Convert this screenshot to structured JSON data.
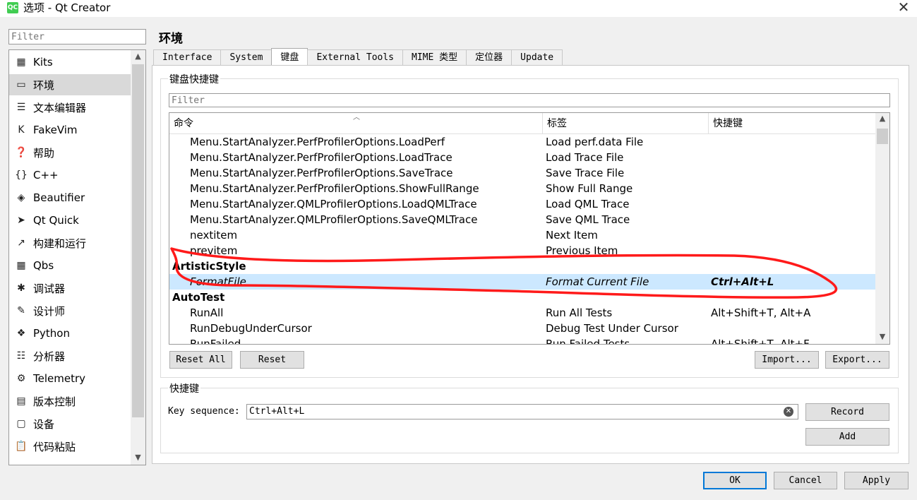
{
  "window": {
    "title": "选项 - Qt Creator",
    "app_icon_text": "QC"
  },
  "sidebar": {
    "filter_placeholder": "Filter",
    "items": [
      {
        "label": "Kits",
        "icon": "kits-icon",
        "glyph": "▦"
      },
      {
        "label": "环境",
        "icon": "monitor-icon",
        "glyph": "▭"
      },
      {
        "label": "文本编辑器",
        "icon": "text-editor-icon",
        "glyph": "☰"
      },
      {
        "label": "FakeVim",
        "icon": "fakevim-icon",
        "glyph": "K"
      },
      {
        "label": "帮助",
        "icon": "help-icon",
        "glyph": "❓"
      },
      {
        "label": "C++",
        "icon": "cpp-icon",
        "glyph": "{}"
      },
      {
        "label": "Beautifier",
        "icon": "beautifier-icon",
        "glyph": "◈"
      },
      {
        "label": "Qt Quick",
        "icon": "qt-quick-icon",
        "glyph": "➤"
      },
      {
        "label": "构建和运行",
        "icon": "build-run-icon",
        "glyph": "↗"
      },
      {
        "label": "Qbs",
        "icon": "qbs-icon",
        "glyph": "▦"
      },
      {
        "label": "调试器",
        "icon": "debugger-icon",
        "glyph": "✱"
      },
      {
        "label": "设计师",
        "icon": "designer-icon",
        "glyph": "✎"
      },
      {
        "label": "Python",
        "icon": "python-icon",
        "glyph": "❖"
      },
      {
        "label": "分析器",
        "icon": "analyzer-icon",
        "glyph": "☷"
      },
      {
        "label": "Telemetry",
        "icon": "telemetry-icon",
        "glyph": "⚙"
      },
      {
        "label": "版本控制",
        "icon": "version-control-icon",
        "glyph": "▤"
      },
      {
        "label": "设备",
        "icon": "device-icon",
        "glyph": "▢"
      },
      {
        "label": "代码粘贴",
        "icon": "code-paste-icon",
        "glyph": "📋"
      }
    ]
  },
  "page": {
    "title": "环境"
  },
  "tabs": [
    "Interface",
    "System",
    "键盘",
    "External Tools",
    "MIME 类型",
    "定位器",
    "Update"
  ],
  "shortcuts": {
    "group_title": "键盘快捷键",
    "filter_placeholder": "Filter",
    "columns": [
      "命令",
      "标签",
      "快捷键"
    ],
    "rows": [
      {
        "command": "Menu.StartAnalyzer.PerfProfilerOptions.LoadPerf",
        "label": "Load perf.data File",
        "shortcut": ""
      },
      {
        "command": "Menu.StartAnalyzer.PerfProfilerOptions.LoadTrace",
        "label": "Load Trace File",
        "shortcut": ""
      },
      {
        "command": "Menu.StartAnalyzer.PerfProfilerOptions.SaveTrace",
        "label": "Save Trace File",
        "shortcut": ""
      },
      {
        "command": "Menu.StartAnalyzer.PerfProfilerOptions.ShowFullRange",
        "label": "Show Full Range",
        "shortcut": ""
      },
      {
        "command": "Menu.StartAnalyzer.QMLProfilerOptions.LoadQMLTrace",
        "label": "Load QML Trace",
        "shortcut": ""
      },
      {
        "command": "Menu.StartAnalyzer.QMLProfilerOptions.SaveQMLTrace",
        "label": "Save QML Trace",
        "shortcut": ""
      },
      {
        "command": "nextitem",
        "label": "Next Item",
        "shortcut": ""
      },
      {
        "command": "previtem",
        "label": "Previous Item",
        "shortcut": ""
      },
      {
        "command": "ArtisticStyle",
        "label": "",
        "shortcut": "",
        "group": true
      },
      {
        "command": "FormatFile",
        "label": "Format Current File",
        "shortcut": "Ctrl+Alt+L",
        "selected": true
      },
      {
        "command": "AutoTest",
        "label": "",
        "shortcut": "",
        "group": true
      },
      {
        "command": "RunAll",
        "label": "Run All Tests",
        "shortcut": "Alt+Shift+T, Alt+A"
      },
      {
        "command": "RunDebugUnderCursor",
        "label": "Debug Test Under Cursor",
        "shortcut": ""
      },
      {
        "command": "RunFailed",
        "label": "Run Failed Tests",
        "shortcut": "Alt+Shift+T, Alt+F"
      }
    ],
    "buttons": {
      "reset_all": "Reset All",
      "reset": "Reset",
      "import": "Import...",
      "export": "Export..."
    }
  },
  "key_editor": {
    "group_title": "快捷键",
    "label": "Key sequence:",
    "value": "Ctrl+Alt+L",
    "record": "Record",
    "add": "Add"
  },
  "dialog_buttons": {
    "ok": "OK",
    "cancel": "Cancel",
    "apply": "Apply"
  },
  "annotation_color": "#ff1a1a"
}
